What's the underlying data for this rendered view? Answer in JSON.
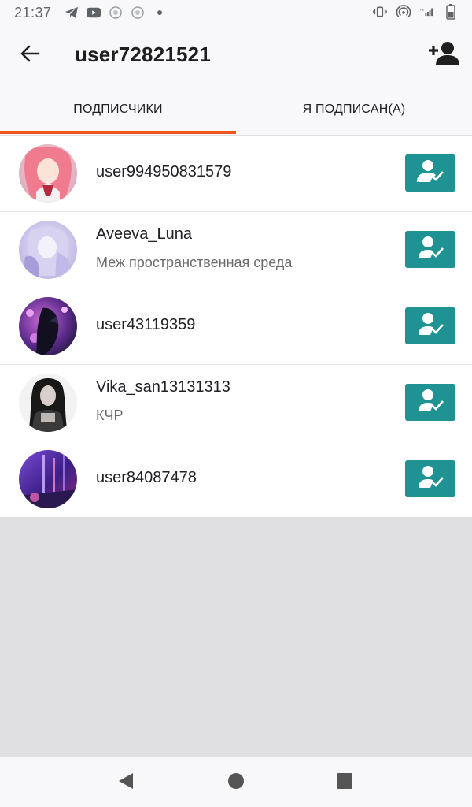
{
  "status_bar": {
    "time": "21:37",
    "left_icons": [
      "telegram-icon",
      "youtube-icon",
      "app-icon",
      "app-icon",
      "dot-icon"
    ],
    "right_icons": [
      "vibrate-icon",
      "hotspot-icon",
      "signal-icon",
      "battery-icon"
    ]
  },
  "header": {
    "title": "user72821521",
    "back_icon": "arrow-left-icon",
    "action_icon": "add-person-icon"
  },
  "tabs": [
    {
      "label": "ПОДПИСЧИКИ",
      "active": true
    },
    {
      "label": "Я ПОДПИСАН(А)",
      "active": false
    }
  ],
  "colors": {
    "accent": "#f0561d",
    "follow_button": "#1f9294",
    "background": "#e0dfe1"
  },
  "users": [
    {
      "name": "user994950831579",
      "subtitle": "",
      "avatar": "avatar-pink-anime"
    },
    {
      "name": "Aveeva_Luna",
      "subtitle": "Меж пространственная среда",
      "avatar": "avatar-lavender-anime"
    },
    {
      "name": "user43119359",
      "subtitle": "",
      "avatar": "avatar-purple-dark"
    },
    {
      "name": "Vika_san13131313",
      "subtitle": "КЧР",
      "avatar": "avatar-dark-girl"
    },
    {
      "name": "user84087478",
      "subtitle": "",
      "avatar": "avatar-violet-lights"
    }
  ],
  "nav_bar": {
    "icons": [
      "back-triangle-icon",
      "home-circle-icon",
      "recents-square-icon"
    ]
  }
}
